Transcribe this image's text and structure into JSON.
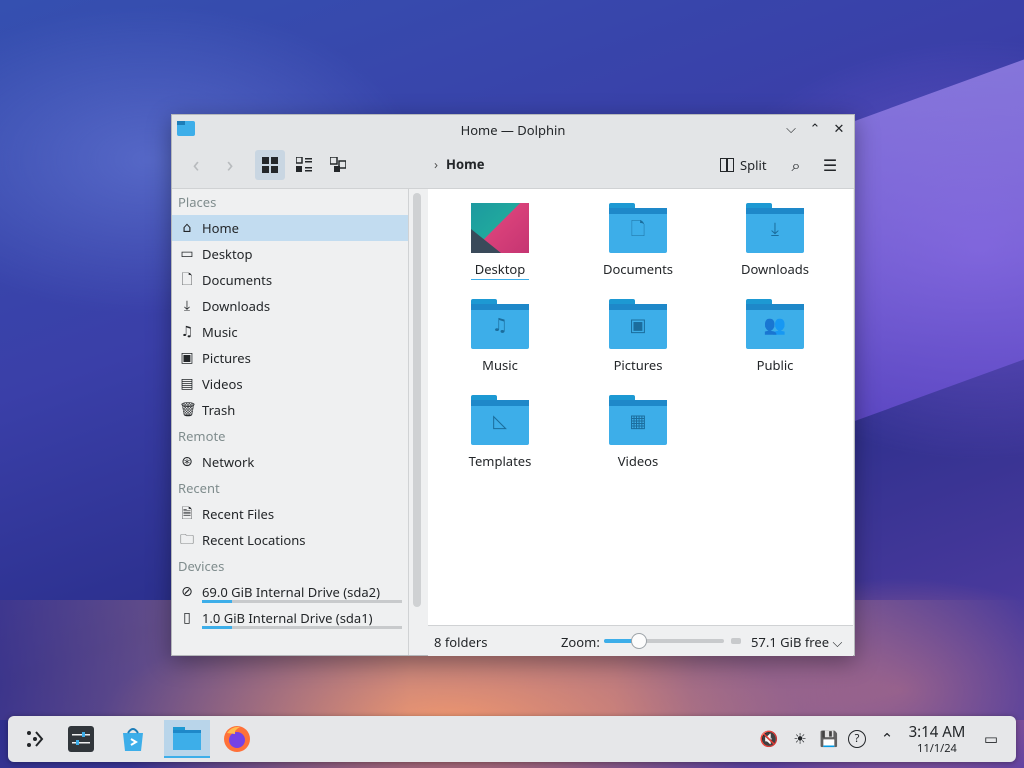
{
  "window": {
    "title": "Home — Dolphin",
    "controls": {
      "minimize": "⌵",
      "maximize": "⌃",
      "close": "✕"
    }
  },
  "toolbar": {
    "back_icon": "‹",
    "forward_icon": "›",
    "breadcrumb_chevron": "›",
    "breadcrumb": "Home",
    "split_label": "Split",
    "search_icon": "⌕",
    "menu_icon": "☰"
  },
  "sidebar": {
    "places_heading": "Places",
    "places": [
      {
        "label": "Home",
        "icon": "⌂"
      },
      {
        "label": "Desktop",
        "icon": "▭"
      },
      {
        "label": "Documents",
        "icon": "🗋"
      },
      {
        "label": "Downloads",
        "icon": "⤓"
      },
      {
        "label": "Music",
        "icon": "♫"
      },
      {
        "label": "Pictures",
        "icon": "▣"
      },
      {
        "label": "Videos",
        "icon": "▤"
      },
      {
        "label": "Trash",
        "icon": "🗑"
      }
    ],
    "remote_heading": "Remote",
    "remote": [
      {
        "label": "Network",
        "icon": "⊛"
      }
    ],
    "recent_heading": "Recent",
    "recent": [
      {
        "label": "Recent Files",
        "icon": "🗎"
      },
      {
        "label": "Recent Locations",
        "icon": "🗀"
      }
    ],
    "devices_heading": "Devices",
    "devices": [
      {
        "label": "69.0 GiB Internal Drive (sda2)",
        "icon": "⊘",
        "usage": 0.15
      },
      {
        "label": "1.0 GiB Internal Drive (sda1)",
        "icon": "▯",
        "usage": 0.15
      }
    ]
  },
  "files": [
    {
      "label": "Desktop",
      "emblem": ""
    },
    {
      "label": "Documents",
      "emblem": "🗋"
    },
    {
      "label": "Downloads",
      "emblem": "⤓"
    },
    {
      "label": "Music",
      "emblem": "♫"
    },
    {
      "label": "Pictures",
      "emblem": "▣"
    },
    {
      "label": "Public",
      "emblem": "👥"
    },
    {
      "label": "Templates",
      "emblem": "◺"
    },
    {
      "label": "Videos",
      "emblem": "▦"
    }
  ],
  "statusbar": {
    "count": "8 folders",
    "zoom_label": "Zoom:",
    "zoom_level": 0.28,
    "free_space": "57.1 GiB free ⌵"
  },
  "taskbar": {
    "clock_time": "3:14 AM",
    "clock_date": "11/1/24",
    "tray_icons": {
      "mute": "🔇",
      "brightness": "☀",
      "save": "💾",
      "help": "?",
      "expand": "⌃",
      "desktop": "▭"
    }
  },
  "colors": {
    "accent": "#3daee9",
    "folder": "#3daee9",
    "selection": "#c2dcf0"
  }
}
